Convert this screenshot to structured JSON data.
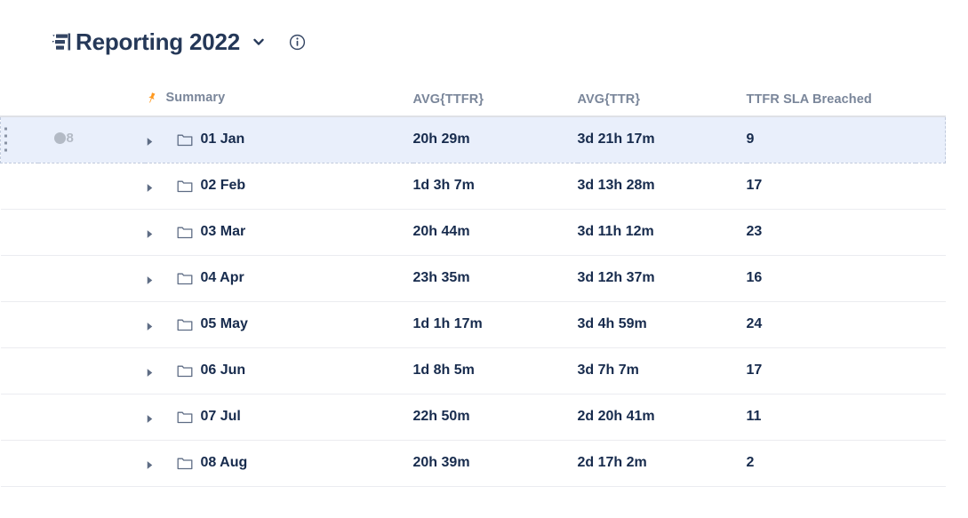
{
  "header": {
    "title": "Reporting 2022",
    "tree_icon": "hierarchy-icon",
    "dropdown_icon": "chevron-down-icon",
    "info_icon": "info-circle-icon"
  },
  "table": {
    "columns": [
      {
        "key": "summary",
        "label": "Summary",
        "pinned": true,
        "pin_icon": "pin-icon",
        "pin_color": "#FF991F"
      },
      {
        "key": "avg_ttfr",
        "label": "AVG{TTFR}"
      },
      {
        "key": "avg_ttr",
        "label": "AVG{TTR}"
      },
      {
        "key": "sla_breached",
        "label": "TTFR SLA Breached"
      }
    ],
    "rows": [
      {
        "summary": "01 Jan",
        "avg_ttfr": "20h 29m",
        "avg_ttr": "3d 21h 17m",
        "sla_breached": "9",
        "selected": true,
        "badge_count": "8",
        "expanded": false
      },
      {
        "summary": "02 Feb",
        "avg_ttfr": "1d 3h 7m",
        "avg_ttr": "3d 13h 28m",
        "sla_breached": "17",
        "selected": false,
        "badge_count": "",
        "expanded": false
      },
      {
        "summary": "03 Mar",
        "avg_ttfr": "20h 44m",
        "avg_ttr": "3d 11h 12m",
        "sla_breached": "23",
        "selected": false,
        "badge_count": "",
        "expanded": false
      },
      {
        "summary": "04 Apr",
        "avg_ttfr": "23h 35m",
        "avg_ttr": "3d 12h 37m",
        "sla_breached": "16",
        "selected": false,
        "badge_count": "",
        "expanded": false
      },
      {
        "summary": "05 May",
        "avg_ttfr": "1d 1h 17m",
        "avg_ttr": "3d 4h 59m",
        "sla_breached": "24",
        "selected": false,
        "badge_count": "",
        "expanded": false
      },
      {
        "summary": "06 Jun",
        "avg_ttfr": "1d 8h 5m",
        "avg_ttr": "3d 7h 7m",
        "sla_breached": "17",
        "selected": false,
        "badge_count": "",
        "expanded": false
      },
      {
        "summary": "07 Jul",
        "avg_ttfr": "22h 50m",
        "avg_ttr": "2d 20h 41m",
        "sla_breached": "11",
        "selected": false,
        "badge_count": "",
        "expanded": false
      },
      {
        "summary": "08 Aug",
        "avg_ttfr": "20h 39m",
        "avg_ttr": "2d 17h 2m",
        "sla_breached": "2",
        "selected": false,
        "badge_count": "",
        "expanded": false
      }
    ]
  },
  "colors": {
    "text_primary": "#172B4D",
    "text_header": "#7A869A",
    "title": "#253858",
    "selected_row_bg": "#E9EFFB",
    "row_divider": "#EBECF0",
    "header_divider": "#DFE1E6",
    "pin_accent": "#FF991F",
    "badge_gray": "#B3BAC5",
    "folder_outline": "#5E6C84"
  }
}
